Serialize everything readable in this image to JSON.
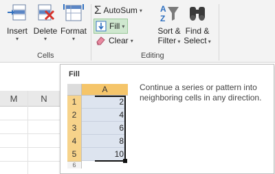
{
  "ribbon": {
    "cells": {
      "insert_label": "Insert",
      "delete_label": "Delete",
      "format_label": "Format",
      "group_label": "Cells"
    },
    "editing": {
      "autosum_label": "AutoSum",
      "fill_label": "Fill",
      "clear_label": "Clear",
      "sort_label_1": "Sort &",
      "sort_label_2": "Filter",
      "find_label_1": "Find &",
      "find_label_2": "Select",
      "group_label": "Editing"
    }
  },
  "sheet": {
    "column_headers": [
      "M",
      "N"
    ]
  },
  "tooltip": {
    "title": "Fill",
    "description": "Continue a series or pattern into neighboring cells in any direction.",
    "mini_sheet": {
      "column_header": "A",
      "row_numbers": [
        "1",
        "2",
        "3",
        "4",
        "5",
        "6"
      ],
      "values": [
        "2",
        "4",
        "6",
        "8",
        "10"
      ]
    }
  },
  "icons": {
    "insert": "insert-cells-icon",
    "delete": "delete-cells-icon",
    "format": "format-cells-icon",
    "autosum": "sigma-icon",
    "fill": "fill-down-icon",
    "clear": "eraser-icon",
    "sort": "sort-filter-icon",
    "find": "binoculars-icon"
  },
  "colors": {
    "fill_highlight": "#cfe7cf",
    "header_orange": "#f5c56a",
    "row_orange": "#f7d38a"
  }
}
